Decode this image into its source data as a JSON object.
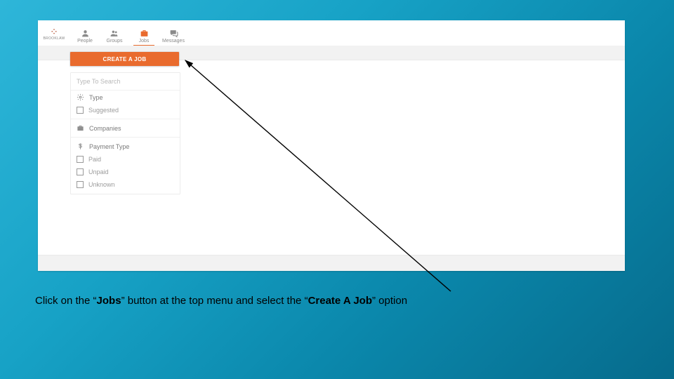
{
  "nav": {
    "logo_sub": "BROOKLAW",
    "items": [
      {
        "label": "People"
      },
      {
        "label": "Groups"
      },
      {
        "label": "Jobs"
      },
      {
        "label": "Messages"
      }
    ]
  },
  "create_job_label": "CREATE A JOB",
  "sidebar": {
    "search_placeholder": "Type To Search",
    "type_heading": "Type",
    "type_options": [
      "Suggested"
    ],
    "companies_heading": "Companies",
    "payment_heading": "Payment Type",
    "payment_options": [
      "Paid",
      "Unpaid",
      "Unknown"
    ]
  },
  "caption": {
    "pre": "Click on the “",
    "jobs": "Jobs",
    "mid": "” button at the top menu and select the “",
    "create": "Create A Job",
    "post": "” option"
  }
}
